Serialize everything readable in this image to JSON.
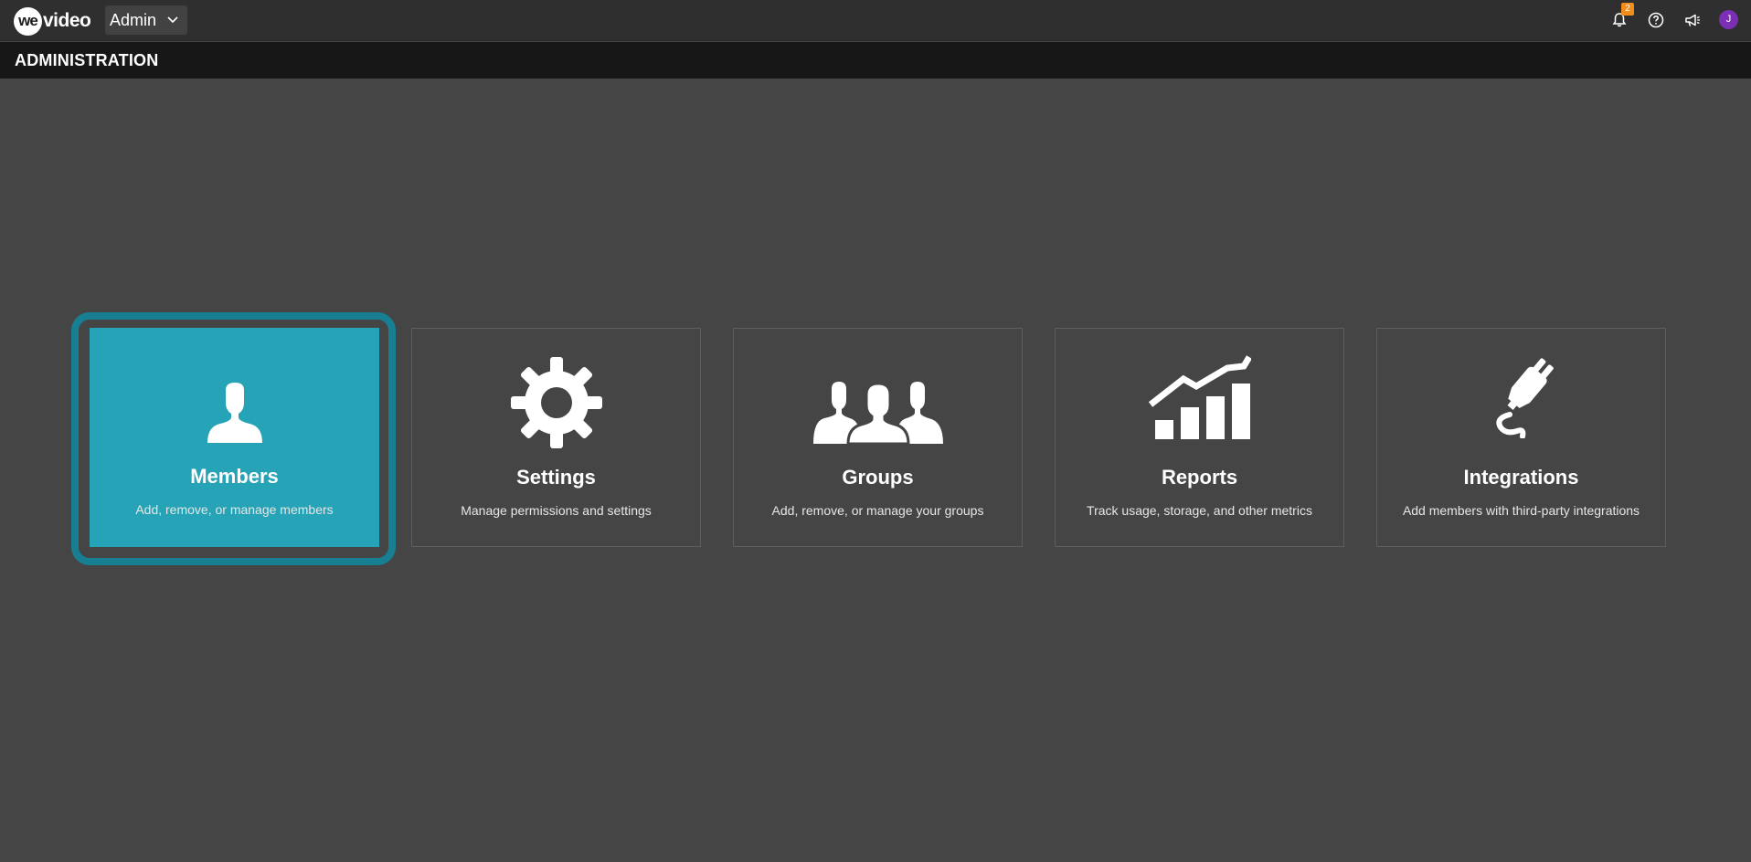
{
  "app": {
    "logo_we": "we",
    "logo_video": "video",
    "role_selector": {
      "value": "Admin",
      "icon": "chevron-down-icon"
    }
  },
  "topbar": {
    "notifications": {
      "icon": "bell-icon",
      "badge_count": "2"
    },
    "help": {
      "icon": "help-circle-icon"
    },
    "announcements": {
      "icon": "megaphone-icon"
    },
    "avatar": {
      "initial": "J",
      "color": "#7b2fb5"
    }
  },
  "header": {
    "title": "ADMINISTRATION"
  },
  "cards": [
    {
      "title": "Members",
      "description": "Add, remove, or manage members",
      "icon": "member-icon",
      "active": true
    },
    {
      "title": "Settings",
      "description": "Manage permissions and settings",
      "icon": "gear-icon",
      "active": false
    },
    {
      "title": "Groups",
      "description": "Add, remove, or manage your groups",
      "icon": "group-icon",
      "active": false
    },
    {
      "title": "Reports",
      "description": "Track usage, storage, and other metrics",
      "icon": "chart-growth-icon",
      "active": false
    },
    {
      "title": "Integrations",
      "description": "Add members with third-party integrations",
      "icon": "plug-icon",
      "active": false
    }
  ],
  "colors": {
    "accent": "#26a3b6",
    "focus_ring": "#187f92",
    "badge": "#f28c1b",
    "background": "#454545"
  }
}
